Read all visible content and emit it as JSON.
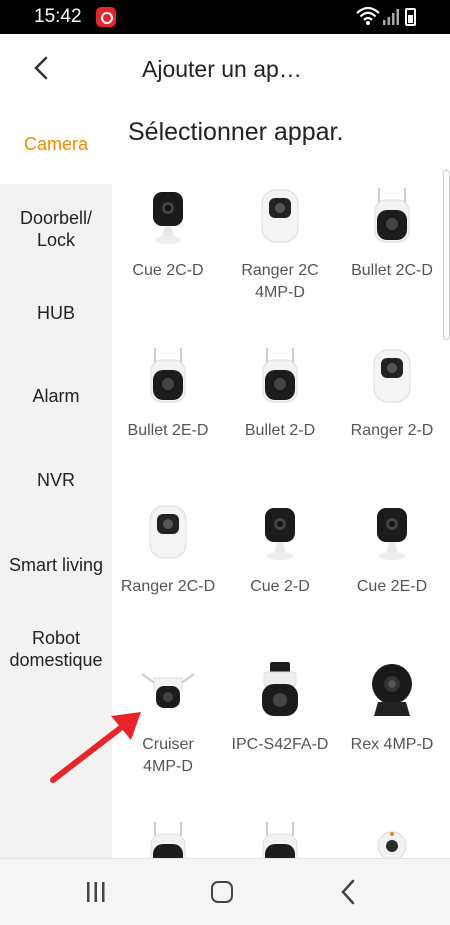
{
  "status": {
    "time": "15:42"
  },
  "header": {
    "title": "Ajouter un ap…"
  },
  "sidebar": {
    "items": [
      {
        "label": "Camera"
      },
      {
        "label": "Doorbell/ Lock"
      },
      {
        "label": "HUB"
      },
      {
        "label": "Alarm"
      },
      {
        "label": "NVR"
      },
      {
        "label": "Smart living"
      },
      {
        "label": "Robot domestique"
      }
    ]
  },
  "content": {
    "heading": "Sélectionner appar.",
    "devices": [
      {
        "name": "Cue 2C-D",
        "icon": "cube-camera-icon"
      },
      {
        "name": "Ranger 2C 4MP-D",
        "icon": "dome-camera-icon"
      },
      {
        "name": "Bullet 2C-D",
        "icon": "bullet-camera-icon"
      },
      {
        "name": "Bullet 2E-D",
        "icon": "bullet-camera-icon"
      },
      {
        "name": "Bullet 2-D",
        "icon": "bullet-camera-icon"
      },
      {
        "name": "Ranger 2-D",
        "icon": "dome-camera-icon"
      },
      {
        "name": "Ranger 2C-D",
        "icon": "dome-camera-icon"
      },
      {
        "name": "Cue 2-D",
        "icon": "cube-camera-icon"
      },
      {
        "name": "Cue 2E-D",
        "icon": "cube-camera-icon"
      },
      {
        "name": "Cruiser 4MP-D",
        "icon": "outdoor-ptz-camera-icon"
      },
      {
        "name": "IPC-S42FA-D",
        "icon": "ptz-camera-icon"
      },
      {
        "name": "Rex 4MP-D",
        "icon": "rex-camera-icon"
      }
    ]
  },
  "annotation": {
    "color": "#e8232a"
  },
  "colors": {
    "accent": "#f08a00",
    "sidebar_bg": "#f2f2f2"
  }
}
